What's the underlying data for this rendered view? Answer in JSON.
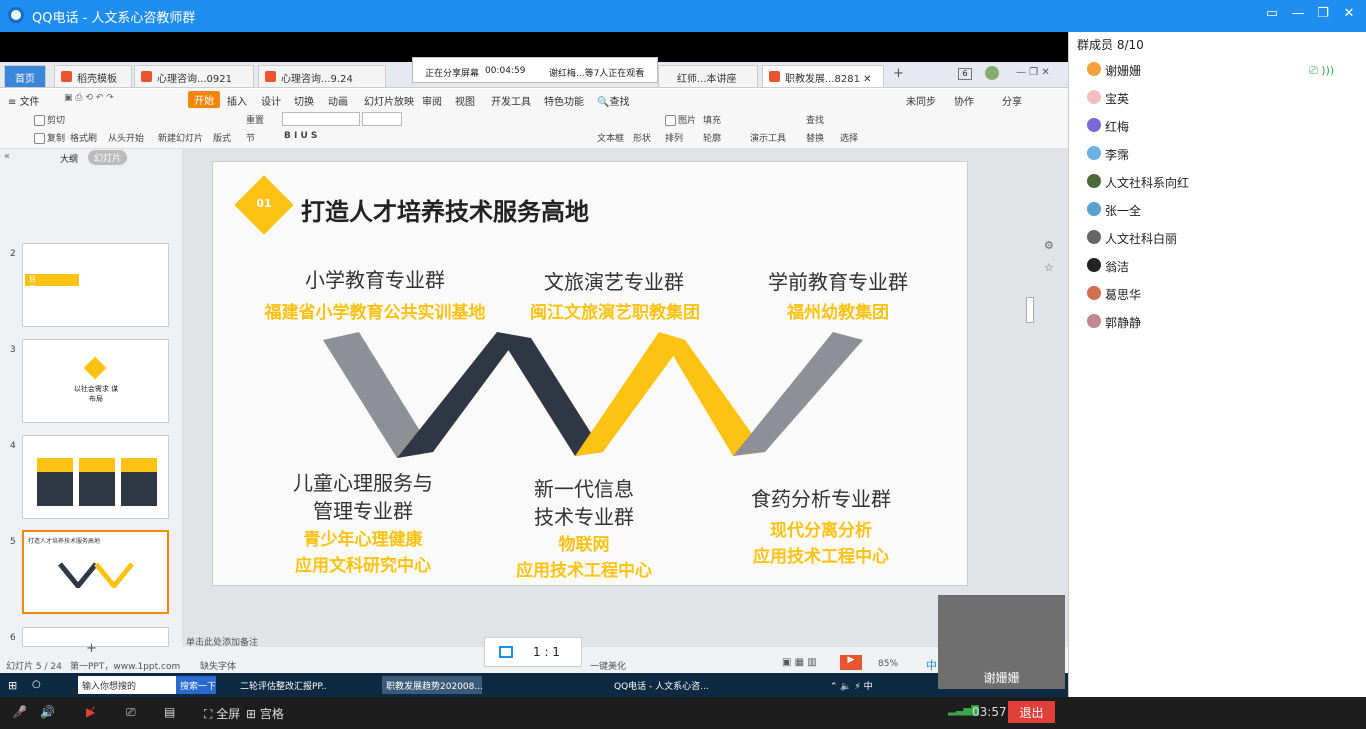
{
  "window": {
    "title": "QQ电话 - 人文系心咨教师群"
  },
  "tabs": [
    {
      "label": "首页"
    },
    {
      "label": "稻壳模板"
    },
    {
      "label": "心理咨询...0921"
    },
    {
      "label": "心理咨询...9.24"
    },
    {
      "label": "红师...本讲座"
    },
    {
      "label": "职教发展...8281"
    }
  ],
  "share": {
    "status": "正在分享屏幕",
    "time": "00:04:59",
    "viewers": "谢红梅...等7人正在观看"
  },
  "menu": [
    "文件",
    "开始",
    "插入",
    "设计",
    "切换",
    "动画",
    "幻灯片放映",
    "审阅",
    "视图",
    "开发工具",
    "特色功能",
    "查找",
    "未同步",
    "协作",
    "分享"
  ],
  "ribbon": [
    "剪切",
    "复制",
    "格式刷",
    "从头开始",
    "新建幻灯片",
    "版式",
    "节",
    "重置",
    "文本框",
    "形状",
    "图片",
    "排列",
    "轮廓",
    "填充",
    "演示工具",
    "替换",
    "选择",
    "查找"
  ],
  "leftpane": {
    "outline_tab": "大纲",
    "slides_tab": "幻灯片",
    "thumb_texts": [
      "目录/CONTENT",
      "以社会需求 谋布局",
      "打造人才培养技术服务高地"
    ]
  },
  "slide": {
    "number": "01",
    "title": "打造人才培养技术服务高地",
    "top_groups": [
      {
        "name": "小学教育专业群",
        "sub": "福建省小学教育公共实训基地"
      },
      {
        "name": "文旅演艺专业群",
        "sub": "闽江文旅演艺职教集团"
      },
      {
        "name": "学前教育专业群",
        "sub": "福州幼教集团"
      }
    ],
    "bottom_groups": [
      {
        "name": "儿童心理服务与\n管理专业群",
        "sub": "青少年心理健康\n应用文科研究中心"
      },
      {
        "name": "新一代信息\n技术专业群",
        "sub": "物联网\n应用技术工程中心"
      },
      {
        "name": "食药分析专业群",
        "sub": "现代分离分析\n应用技术工程中心"
      }
    ],
    "w_colors": [
      "#8e9095",
      "#2f3745",
      "#fec213",
      "#8e9095"
    ]
  },
  "notes_placeholder": "单击此处添加备注",
  "status": {
    "slide_count": "幻灯片 5 / 24",
    "theme": "第一PPT，www.1ppt.com",
    "font": "缺失字体",
    "beautify": "一键美化",
    "zoom": "85%",
    "ime": "中"
  },
  "taskbar": {
    "search": "输入你想搜的",
    "search_btn": "搜索一下",
    "items": [
      "二轮评估整改汇报PP...",
      "职教发展趋势202008...",
      "QQ电话 - 人文系心咨..."
    ]
  },
  "ratio": "1 : 1",
  "collapse": "收起",
  "members": {
    "header": "群成员 8/10",
    "list": [
      "谢姗姗",
      "宝英",
      "红梅",
      "李霈",
      "人文社科系向红",
      "张一全",
      "人文社科白丽",
      "翁洁",
      "葛思华",
      "郭静静"
    ]
  },
  "camera_name": "谢姗姗",
  "bottombar": {
    "fullscreen": "全屏",
    "grid": "宫格",
    "time": "03:57",
    "exit": "退出"
  },
  "colors": {
    "accent": "#1f8ef0",
    "yellow": "#fec213",
    "exit_red": "#e1403a"
  }
}
